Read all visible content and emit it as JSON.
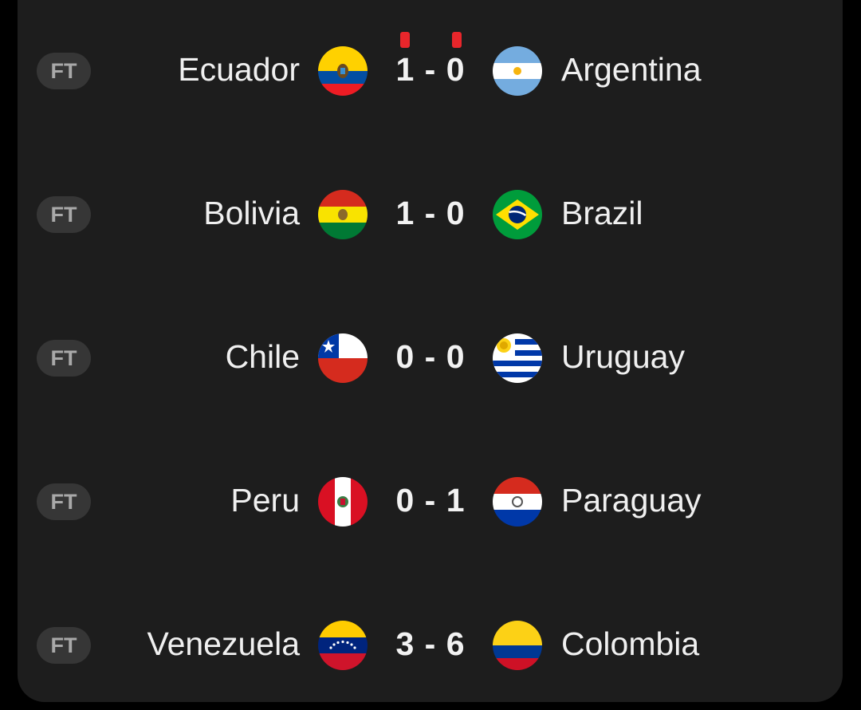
{
  "matches": [
    {
      "status": "FT",
      "home": {
        "name": "Ecuador",
        "flag": "ecuador-flag-icon"
      },
      "away": {
        "name": "Argentina",
        "flag": "argentina-flag-icon"
      },
      "score": "1 - 0",
      "home_red_cards": 1,
      "away_red_cards": 1
    },
    {
      "status": "FT",
      "home": {
        "name": "Bolivia",
        "flag": "bolivia-flag-icon"
      },
      "away": {
        "name": "Brazil",
        "flag": "brazil-flag-icon"
      },
      "score": "1 - 0",
      "home_red_cards": 0,
      "away_red_cards": 0
    },
    {
      "status": "FT",
      "home": {
        "name": "Chile",
        "flag": "chile-flag-icon"
      },
      "away": {
        "name": "Uruguay",
        "flag": "uruguay-flag-icon"
      },
      "score": "0 - 0",
      "home_red_cards": 0,
      "away_red_cards": 0
    },
    {
      "status": "FT",
      "home": {
        "name": "Peru",
        "flag": "peru-flag-icon"
      },
      "away": {
        "name": "Paraguay",
        "flag": "paraguay-flag-icon"
      },
      "score": "0 - 1",
      "home_red_cards": 0,
      "away_red_cards": 0
    },
    {
      "status": "FT",
      "home": {
        "name": "Venezuela",
        "flag": "venezuela-flag-icon"
      },
      "away": {
        "name": "Colombia",
        "flag": "colombia-flag-icon"
      },
      "score": "3 - 6",
      "home_red_cards": 0,
      "away_red_cards": 0
    }
  ],
  "colors": {
    "background": "#000000",
    "card": "#1d1d1d",
    "status_pill": "#363636",
    "status_text": "#a9a9a9",
    "text": "#f0f0f0",
    "red_card": "#e8262b"
  }
}
